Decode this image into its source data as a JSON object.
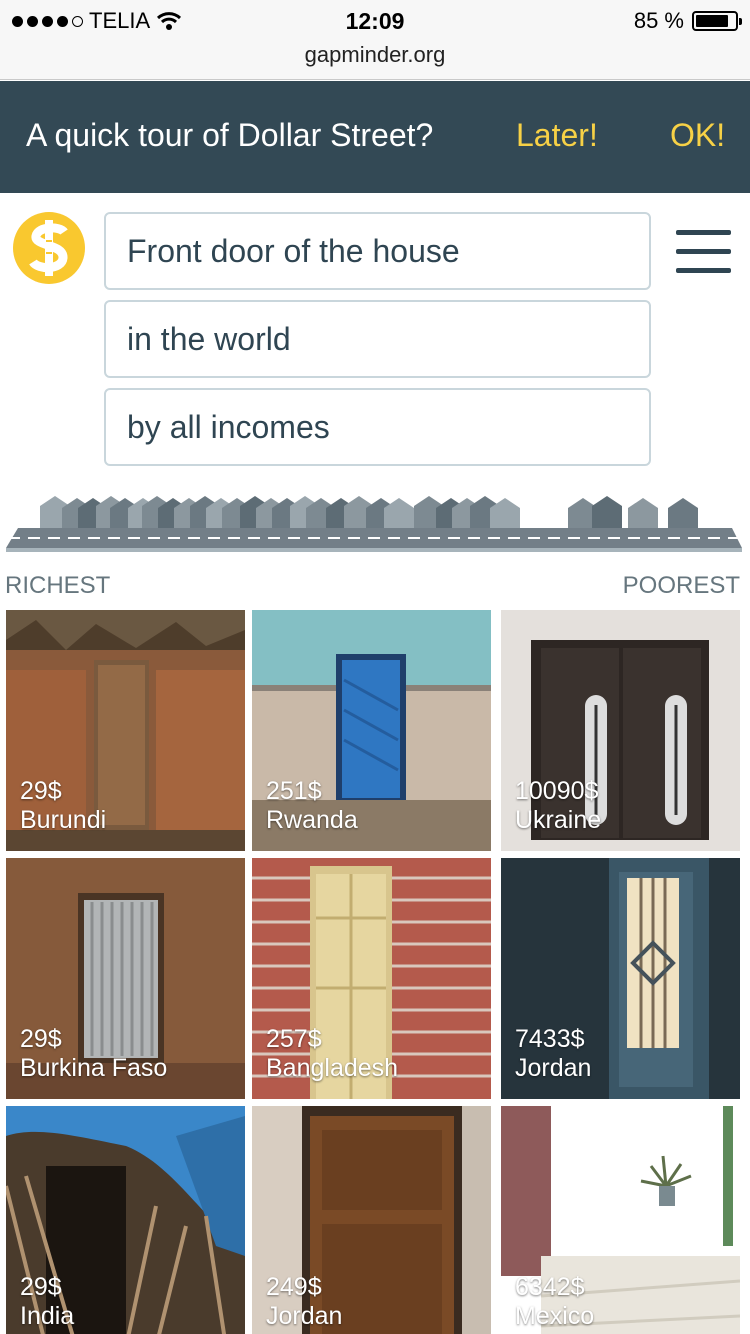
{
  "status_bar": {
    "carrier": "TELIA",
    "time": "12:09",
    "battery": "85 %",
    "battery_level": 0.85,
    "url": "gapminder.org"
  },
  "tour": {
    "text": "A quick tour of Dollar Street?",
    "later": "Later!",
    "ok": "OK!"
  },
  "filters": {
    "thing": "Front door of the house",
    "place": "in the world",
    "income": "by all incomes"
  },
  "street": {
    "richest": "RICHEST",
    "poorest": "POOREST"
  },
  "homes": [
    {
      "income": "29$",
      "country": "Burundi",
      "theme": "mud-hut"
    },
    {
      "income": "251$",
      "country": "Rwanda",
      "theme": "blue-door"
    },
    {
      "income": "10090$",
      "country": "Ukraine",
      "theme": "dark-double-door"
    },
    {
      "income": "29$",
      "country": "Burkina Faso",
      "theme": "tin-door"
    },
    {
      "income": "257$",
      "country": "Bangladesh",
      "theme": "brick-wall"
    },
    {
      "income": "7433$",
      "country": "Jordan",
      "theme": "glass-door"
    },
    {
      "income": "29$",
      "country": "India",
      "theme": "tarp-hut"
    },
    {
      "income": "249$",
      "country": "Jordan",
      "theme": "wood-door"
    },
    {
      "income": "6342$",
      "country": "Mexico",
      "theme": "courtyard"
    }
  ],
  "colors": {
    "banner": "#334955",
    "accent": "#f7d146",
    "logo": "#f9c82f",
    "text": "#2f4552"
  }
}
